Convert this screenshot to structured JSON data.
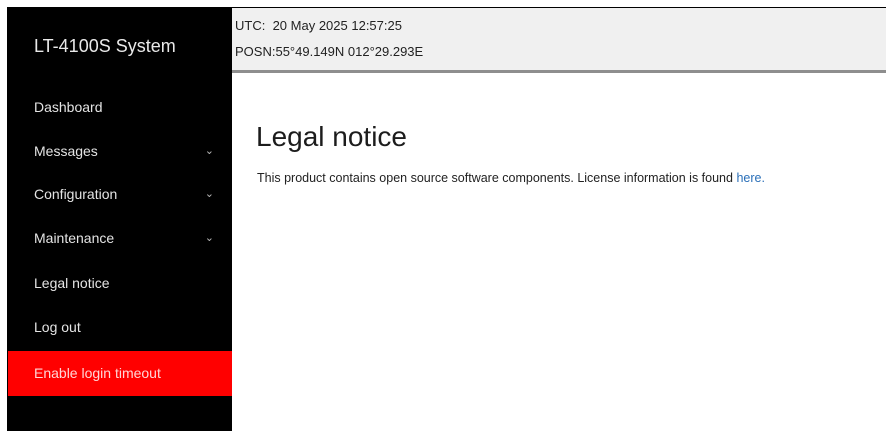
{
  "sidebar": {
    "brand": "LT-4100S System",
    "items": [
      {
        "label": "Dashboard",
        "chevron": false
      },
      {
        "label": "Messages",
        "chevron": true
      },
      {
        "label": "Configuration",
        "chevron": true
      },
      {
        "label": "Maintenance",
        "chevron": true
      },
      {
        "label": "Legal notice",
        "chevron": false
      },
      {
        "label": "Log out",
        "chevron": false
      },
      {
        "label": "Enable login timeout",
        "chevron": false,
        "highlighted": true
      }
    ],
    "chevron_glyph": "⌄",
    "chevron_icon": "chevron-down-icon"
  },
  "header": {
    "utc_label": "UTC:",
    "utc_value": "20 May 2025 12:57:25",
    "posn_label": "POSN:",
    "posn_value": "55°49.149N 012°29.293E"
  },
  "main": {
    "title": "Legal notice",
    "text": "This product contains open source software components. License information is found ",
    "link_text": "here."
  },
  "colors": {
    "sidebar_bg": "#000000",
    "highlight": "#ff0000",
    "header_bg": "#f0f0f0",
    "link": "#2a6fb8"
  }
}
